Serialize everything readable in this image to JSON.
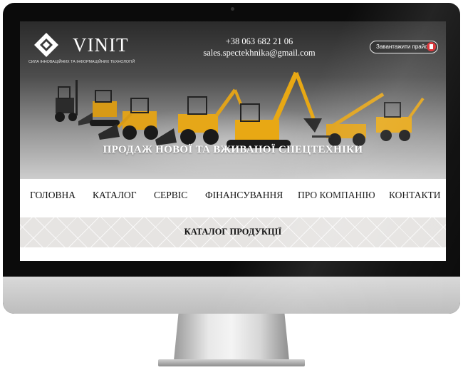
{
  "brand": {
    "name": "VINIT",
    "tagline": "СИЛА ІННОВАЦІЙНИХ ТА ІНФОРМАЦІЙНИХ ТЕХНОЛОГІЙ"
  },
  "contacts": {
    "phone": "+38 063 682 21 06",
    "email": "sales.spectekhnika@gmail.com"
  },
  "header": {
    "price_button_label": "Завантажити прайс"
  },
  "hero": {
    "headline": "ПРОДАЖ НОВОЇ ТА ВЖИВАНОЇ СПЕЦТЕХНІКИ"
  },
  "nav": {
    "items": [
      {
        "label": "ГОЛОВНА"
      },
      {
        "label": "КАТАЛОГ"
      },
      {
        "label": "СЕРВІС"
      },
      {
        "label": "ФІНАНСУВАННЯ"
      },
      {
        "label": "ПРО КОМПАНІЮ"
      },
      {
        "label": "КОНТАКТИ"
      }
    ]
  },
  "catalog": {
    "title": "КАТАЛОГ ПРОДУКЦІЇ"
  },
  "colors": {
    "machine_yellow": "#e0a21a",
    "pdf_red": "#d7262b",
    "nav_text": "#111111"
  }
}
